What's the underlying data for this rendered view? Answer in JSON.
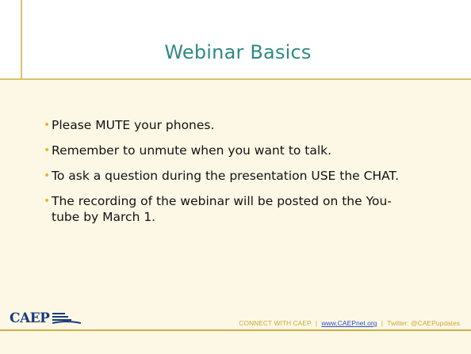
{
  "slide": {
    "title": "Webinar Basics",
    "bullets": [
      {
        "text": "Please MUTE your phones."
      },
      {
        "text": "Remember to unmute when you want to talk."
      },
      {
        "text": "To ask a question during the presentation USE the CHAT."
      },
      {
        "text": "The recording of the webinar will be posted on the You-tube by March 1."
      }
    ]
  },
  "footer": {
    "logo_text": "CAEP",
    "connect_text": "CONNECT WITH CAEP",
    "separator": "|",
    "website_link": "www.CAEPnet.org",
    "twitter_text": "Twitter: @CAEPupdates"
  },
  "colors": {
    "title": "#2e8a82",
    "bullet_marker": "#e5b533",
    "background": "#fdf8e6",
    "accent": "#d8c46a",
    "logo": "#1b3a7a",
    "link": "#2b4fc7"
  },
  "icons": {
    "logo_mark": "caep-logo-lines-icon",
    "bullet": "bullet-dot-icon"
  }
}
